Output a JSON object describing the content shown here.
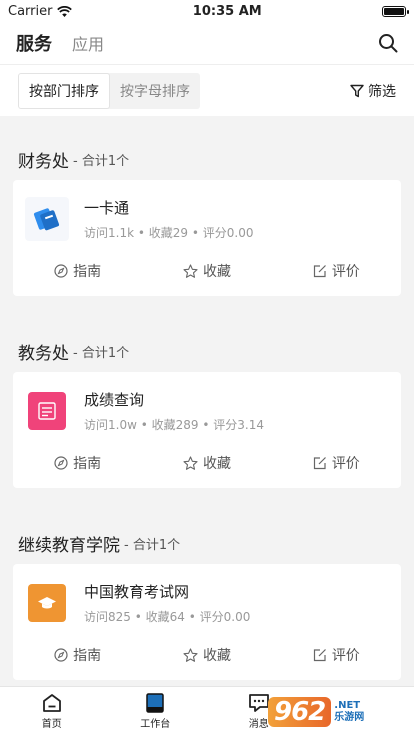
{
  "status": {
    "carrier": "Carrier",
    "time": "10:35 AM",
    "battery_level": 1.0
  },
  "nav": {
    "tab_active": "服务",
    "tab_inactive": "应用"
  },
  "filter": {
    "sort_dept": "按部门排序",
    "sort_alpha": "按字母排序",
    "filter_label": "筛选"
  },
  "actions": {
    "guide": "指南",
    "favorite": "收藏",
    "review": "评价"
  },
  "sections": [
    {
      "title": "财务处",
      "count": "- 合计1个",
      "app": {
        "name": "一卡通",
        "icon": "card-icon",
        "icon_color": "#2f8ded",
        "visits": "访问1.1k",
        "favs": "收藏29",
        "score": "评分0.00"
      }
    },
    {
      "title": "教务处",
      "count": "- 合计1个",
      "app": {
        "name": "成绩查询",
        "icon": "score-report-icon",
        "icon_color": "#f0437a",
        "visits": "访问1.0w",
        "favs": "收藏289",
        "score": "评分3.14"
      }
    },
    {
      "title": "继续教育学院",
      "count": "- 合计1个",
      "app": {
        "name": "中国教育考试网",
        "icon": "graduation-cap-icon",
        "icon_color": "#ef9532",
        "visits": "访问825",
        "favs": "收藏64",
        "score": "评分0.00"
      }
    }
  ],
  "tabbar": {
    "home": "首页",
    "workbench": "工作台",
    "messages": "消息"
  },
  "watermark": {
    "logo": "962",
    "net": ".NET",
    "site": "乐游网"
  },
  "colors": {
    "accent_blue": "#1d6fb8",
    "text": "#222222",
    "muted": "#999999"
  }
}
